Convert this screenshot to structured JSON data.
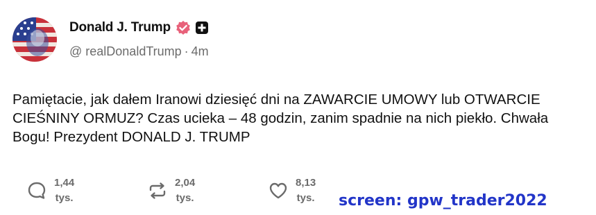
{
  "author": {
    "display_name": "Donald J. Trump",
    "handle": "@ realDonaldTrump",
    "separator": "·",
    "time": "4m"
  },
  "post": {
    "text": "Pamiętacie, jak dałem Iranowi dziesięć dni na ZAWARCIE UMOWY lub OTWARCIE CIEŚNINY ORMUZ? Czas ucieka – 48 godzin, zanim spadnie na nich piekło. Chwała Bogu! Prezydent DONALD J. TRUMP"
  },
  "actions": {
    "replies": {
      "count": "1,44",
      "unit": "tys.",
      "icon": "comment-icon"
    },
    "reposts": {
      "count": "2,04",
      "unit": "tys.",
      "icon": "repost-icon"
    },
    "likes": {
      "count": "8,13",
      "unit": "tys.",
      "icon": "heart-icon"
    }
  },
  "watermark": "screen: gpw_trader2022",
  "colors": {
    "verified_badge": "#e8617a",
    "watermark": "#2235c8",
    "muted_text": "#6b6b6b"
  }
}
